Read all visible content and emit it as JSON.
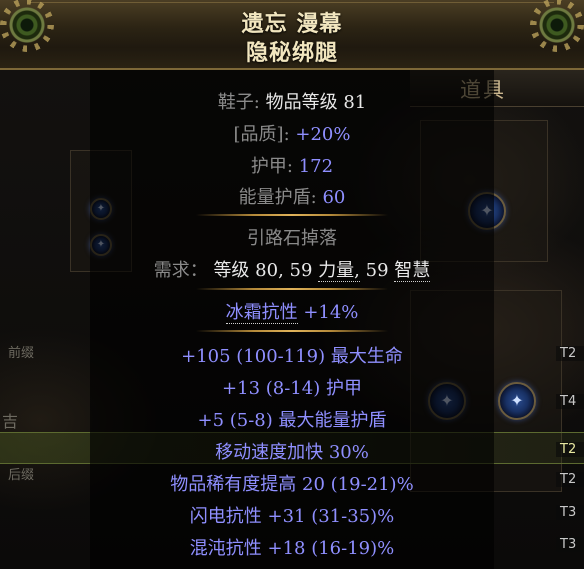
{
  "inventory": {
    "title": "道具",
    "left_labels": {
      "prefix": "前缀",
      "suffix": "后缀",
      "char": "吉"
    },
    "tiers": [
      "T2",
      "T4",
      "T2",
      "T2",
      "T3",
      "T3"
    ]
  },
  "item": {
    "name_line1": "遗忘 漫幕",
    "name_line2": "隐秘绑腿",
    "type_prefix": "鞋子: ",
    "item_level_label": "物品等级",
    "item_level_value": "81",
    "quality_label": "[品质]:",
    "quality_value": "+20%",
    "armour_label": "护甲:",
    "armour_value": "172",
    "es_label": "能量护盾:",
    "es_value": "60",
    "drop_note": "引路石掉落",
    "req_label": "需求：",
    "req_level_label": "等级",
    "req_level_value": "80,",
    "req_str_value": "59",
    "req_str_label": "力量,",
    "req_int_value": "59",
    "req_int_label": "智慧",
    "implicit": {
      "name": "冰霜抗性",
      "value": "+14%"
    },
    "mods": [
      "+105 (100-119) 最大生命",
      "+13 (8-14) 护甲",
      "+5 (5-8) 最大能量护盾",
      "移动速度加快 30%",
      "物品稀有度提高 20 (19-21)%",
      "闪电抗性 +31 (31-35)%",
      "混沌抗性 +18 (16-19)%"
    ]
  },
  "colors": {
    "header_text": "#f2e6bf",
    "property_value": "#8f8fff",
    "separator": "#e0b35a"
  },
  "icons": [
    "ornament-left-icon",
    "ornament-right-icon",
    "socket-icon"
  ]
}
